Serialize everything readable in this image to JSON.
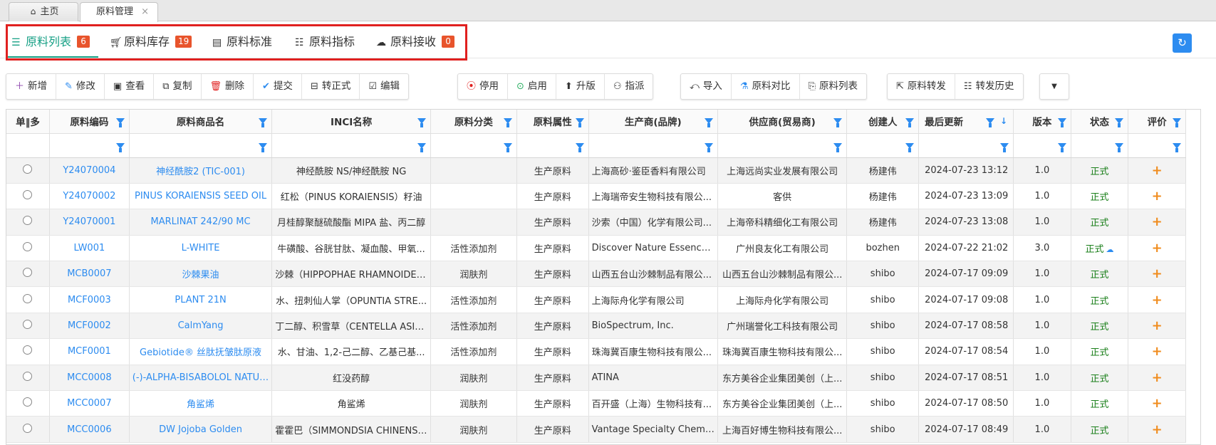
{
  "page_tabs": [
    {
      "label": "主页",
      "icon": "home-icon",
      "active": false
    },
    {
      "label": "原料管理",
      "active": true,
      "close": "×"
    }
  ],
  "sub_tabs": [
    {
      "label": "原料列表",
      "icon": "database-icon",
      "badge": "6",
      "active": true
    },
    {
      "label": "原料库存",
      "icon": "cart-icon",
      "badge": "19"
    },
    {
      "label": "原料标准",
      "icon": "calendar-icon"
    },
    {
      "label": "原料指标",
      "icon": "list-icon"
    },
    {
      "label": "原料接收",
      "icon": "upload-cloud-icon",
      "badge": "0"
    }
  ],
  "colors": {
    "accent": "#16a085",
    "link": "#2d8cf0",
    "badge": "#e8542c",
    "status": "#1a7f1a",
    "rate": "#f08c1e",
    "highlight_border": "#e0201f"
  },
  "toolbar": {
    "group1": [
      {
        "label": "新增",
        "icon": "plus-icon"
      },
      {
        "label": "修改",
        "icon": "pencil-icon"
      },
      {
        "label": "查看",
        "icon": "view-icon"
      },
      {
        "label": "复制",
        "icon": "copy-icon"
      },
      {
        "label": "删除",
        "icon": "trash-icon"
      },
      {
        "label": "提交",
        "icon": "check-icon"
      },
      {
        "label": "转正式",
        "icon": "convert-icon"
      },
      {
        "label": "编辑",
        "icon": "edit-icon"
      }
    ],
    "group2": [
      {
        "label": "停用",
        "icon": "stop-icon"
      },
      {
        "label": "启用",
        "icon": "enable-icon"
      },
      {
        "label": "升版",
        "icon": "arrow-up-icon"
      },
      {
        "label": "指派",
        "icon": "assign-icon"
      }
    ],
    "group3": [
      {
        "label": "导入",
        "icon": "import-icon"
      },
      {
        "label": "原料对比",
        "icon": "compare-icon"
      },
      {
        "label": "原料列表",
        "icon": "file-list-icon"
      }
    ],
    "group4": [
      {
        "label": "原料转发",
        "icon": "forward-icon"
      },
      {
        "label": "转发历史",
        "icon": "history-icon"
      }
    ]
  },
  "columns": [
    "单‖多",
    "原料编码",
    "原料商品名",
    "INCI名称",
    "原料分类",
    "原料属性",
    "生产商(品牌)",
    "供应商(贸易商)",
    "创建人",
    "最后更新",
    "版本",
    "状态",
    "评价"
  ],
  "rows": [
    {
      "code": "Y24070004",
      "name": "神经酰胺2 (TIC-001)",
      "inci": "神经酰胺 NS/神经酰胺 NG",
      "category": "",
      "attr": "生产原料",
      "maker": "上海高砂·鉴臣香料有限公司",
      "supplier": "上海远尚实业发展有限公司",
      "creator": "杨建伟",
      "updated": "2024-07-23 13:12",
      "version": "1.0",
      "status": "正式",
      "rate": "+"
    },
    {
      "code": "Y24070002",
      "name": "PINUS KORAIENSIS SEED OIL",
      "inci": "红松（PINUS KORAIENSIS）籽油",
      "category": "",
      "attr": "生产原料",
      "maker": "上海瑞帝安生物科技有限公...",
      "supplier": "客供",
      "creator": "杨建伟",
      "updated": "2024-07-23 13:09",
      "version": "1.0",
      "status": "正式",
      "rate": "+"
    },
    {
      "code": "Y24070001",
      "name": "MARLINAT 242/90 MC",
      "inci": "月桂醇聚醚硫酸酯 MIPA 盐、丙二醇",
      "category": "",
      "attr": "生产原料",
      "maker": "沙索（中国）化学有限公司...",
      "supplier": "上海帝科精细化工有限公司",
      "creator": "杨建伟",
      "updated": "2024-07-23 13:08",
      "version": "1.0",
      "status": "正式",
      "rate": "+"
    },
    {
      "code": "LW001",
      "name": "L-WHITE",
      "inci": "牛磺酸、谷胱甘肽、凝血酸、甲氧...",
      "category": "活性添加剂",
      "attr": "生产原料",
      "maker": "Discover Nature Essence C...",
      "supplier": "广州良友化工有限公司",
      "creator": "bozhen",
      "updated": "2024-07-22 21:02",
      "version": "3.0",
      "status": "正式",
      "cloud": true,
      "rate": "+"
    },
    {
      "code": "MCB0007",
      "name": "沙棘果油",
      "inci": "沙棘（HIPPOPHAE RHAMNOIDES...",
      "category": "润肤剂",
      "attr": "生产原料",
      "maker": "山西五台山沙棘制品有限公...",
      "supplier": "山西五台山沙棘制品有限公...",
      "creator": "shibo",
      "updated": "2024-07-17 09:09",
      "version": "1.0",
      "status": "正式",
      "rate": "+"
    },
    {
      "code": "MCF0003",
      "name": "PLANT 21N",
      "inci": "水、扭刺仙人掌（OPUNTIA STRE...",
      "category": "活性添加剂",
      "attr": "生产原料",
      "maker": "上海际舟化学有限公司",
      "supplier": "上海际舟化学有限公司",
      "creator": "shibo",
      "updated": "2024-07-17 09:08",
      "version": "1.0",
      "status": "正式",
      "rate": "+"
    },
    {
      "code": "MCF0002",
      "name": "CalmYang",
      "inci": "丁二醇、积雪草（CENTELLA ASIA...",
      "category": "活性添加剂",
      "attr": "生产原料",
      "maker": "BioSpectrum, Inc.",
      "supplier": "广州瑞誉化工科技有限公司",
      "creator": "shibo",
      "updated": "2024-07-17 08:58",
      "version": "1.0",
      "status": "正式",
      "rate": "+"
    },
    {
      "code": "MCF0001",
      "name": "Gebiotide® 丝肽抚皱肽原液",
      "inci": "水、甘油、1,2-己二醇、乙基己基...",
      "category": "活性添加剂",
      "attr": "生产原料",
      "maker": "珠海冀百康生物科技有限公...",
      "supplier": "珠海冀百康生物科技有限公...",
      "creator": "shibo",
      "updated": "2024-07-17 08:54",
      "version": "1.0",
      "status": "正式",
      "rate": "+"
    },
    {
      "code": "MCC0008",
      "name": "(-)-ALPHA-BISABOLOL NATUR...",
      "inci": "红没药醇",
      "category": "润肤剂",
      "attr": "生产原料",
      "maker": "ATINA",
      "supplier": "东方美谷企业集团美创（上...",
      "creator": "shibo",
      "updated": "2024-07-17 08:51",
      "version": "1.0",
      "status": "正式",
      "rate": "+"
    },
    {
      "code": "MCC0007",
      "name": "角鲨烯",
      "inci": "角鲨烯",
      "category": "润肤剂",
      "attr": "生产原料",
      "maker": "百开盛（上海）生物科技有...",
      "supplier": "东方美谷企业集团美创（上...",
      "creator": "shibo",
      "updated": "2024-07-17 08:50",
      "version": "1.0",
      "status": "正式",
      "rate": "+"
    },
    {
      "code": "MCC0006",
      "name": "DW Jojoba Golden",
      "inci": "霍霍巴（SIMMONDSIA CHINENSI...",
      "category": "润肤剂",
      "attr": "生产原料",
      "maker": "Vantage Specialty Chemica...",
      "supplier": "上海百好博生物科技有限公...",
      "creator": "shibo",
      "updated": "2024-07-17 08:49",
      "version": "1.0",
      "status": "正式",
      "rate": "+"
    }
  ]
}
